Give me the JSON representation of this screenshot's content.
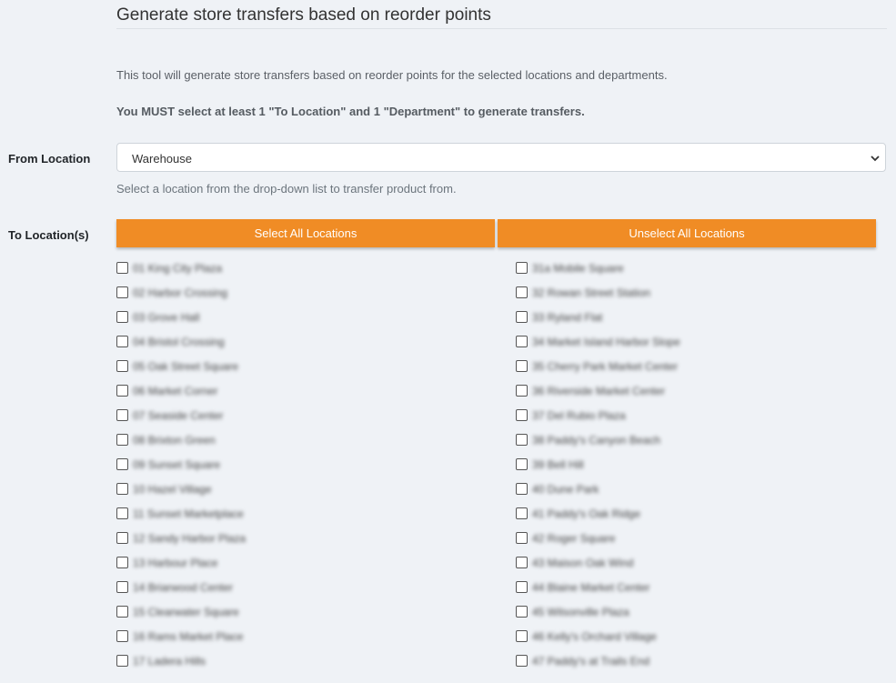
{
  "page": {
    "title": "Generate store transfers based on reorder points",
    "intro": "This tool will generate store transfers based on reorder points for the selected locations and departments.",
    "warning": "You MUST select at least 1 \"To Location\" and 1 \"Department\" to generate transfers."
  },
  "from_location": {
    "label": "From Location",
    "selected": "Warehouse",
    "help": "Select a location from the drop-down list to transfer product from."
  },
  "to_locations": {
    "label": "To Location(s)",
    "select_all": "Select All Locations",
    "unselect_all": "Unselect All Locations",
    "left": [
      "01 King City Plaza",
      "02 Harbor Crossing",
      "03 Grove Hall",
      "04 Bristol Crossing",
      "05 Oak Street Square",
      "06 Market Corner",
      "07 Seaside Center",
      "08 Brixton Green",
      "09 Sunset Square",
      "10 Hazel Village",
      "11 Sunset Marketplace",
      "12 Sandy Harbor Plaza",
      "13 Harbour Place",
      "14 Briarwood Center",
      "15 Clearwater Square",
      "16 Rams Market Place",
      "17 Ladera Hills"
    ],
    "right": [
      "31a Mobile Square",
      "32 Rowan Street Station",
      "33 Ryland Flat",
      "34 Market Island Harbor Slope",
      "35 Cherry Park Market Center",
      "36 Riverside Market Center",
      "37 Del Rubio Plaza",
      "38 Paddy's Canyon Beach",
      "39 Bell Hill",
      "40 Dune Park",
      "41 Paddy's Oak Ridge",
      "42 Roger Square",
      "43 Maison Oak Wind",
      "44 Blaine Market Center",
      "45 Wilsonville Plaza",
      "46 Kelly's Orchard Village",
      "47 Paddy's at Trails End"
    ]
  }
}
